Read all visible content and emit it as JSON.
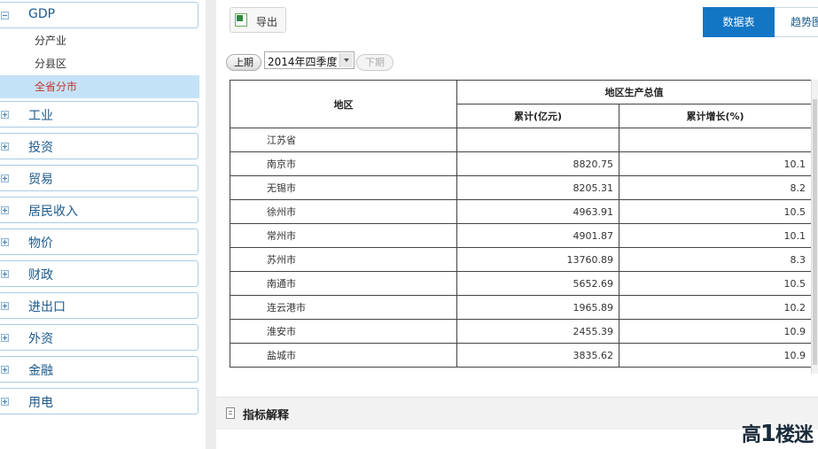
{
  "sidebar": {
    "gdp": {
      "label": "GDP",
      "items": [
        "分产业",
        "分县区",
        "全省分市"
      ],
      "active_index": 2
    },
    "categories": [
      "工业",
      "投资",
      "贸易",
      "居民收入",
      "物价",
      "财政",
      "进出口",
      "外资",
      "金融",
      "用电"
    ]
  },
  "toolbar": {
    "export_label": "导出"
  },
  "tabs": {
    "data_table": "数据表",
    "trend": "趋势图"
  },
  "period": {
    "prev_label": "上期",
    "next_label": "下期",
    "selected": "2014年四季度"
  },
  "table": {
    "header_region": "地区",
    "header_group": "地区生产总值",
    "header_cumulative": "累计(亿元)",
    "header_growth": "累计增长(%)",
    "rows": [
      {
        "region": "江苏省",
        "value": "",
        "growth": ""
      },
      {
        "region": "南京市",
        "value": "8820.75",
        "growth": "10.1"
      },
      {
        "region": "无锡市",
        "value": "8205.31",
        "growth": "8.2"
      },
      {
        "region": "徐州市",
        "value": "4963.91",
        "growth": "10.5"
      },
      {
        "region": "常州市",
        "value": "4901.87",
        "growth": "10.1"
      },
      {
        "region": "苏州市",
        "value": "13760.89",
        "growth": "8.3"
      },
      {
        "region": "南通市",
        "value": "5652.69",
        "growth": "10.5"
      },
      {
        "region": "连云港市",
        "value": "1965.89",
        "growth": "10.2"
      },
      {
        "region": "淮安市",
        "value": "2455.39",
        "growth": "10.9"
      },
      {
        "region": "盐城市",
        "value": "3835.62",
        "growth": "10.9"
      }
    ]
  },
  "indicator": {
    "title": "指标解释"
  },
  "watermark": "高楼迷"
}
